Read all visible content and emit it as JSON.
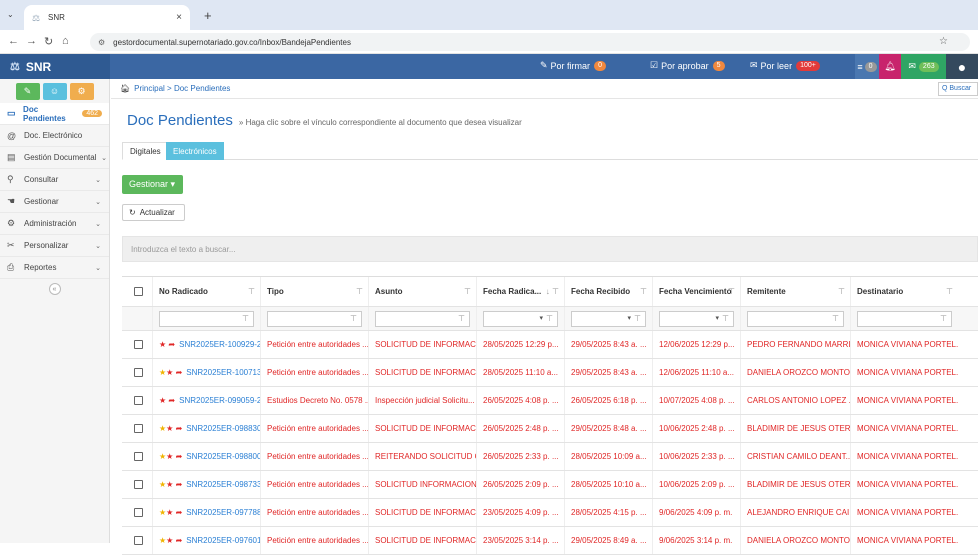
{
  "browser": {
    "tab_title": "SNR",
    "url": "gestordocumental.supernotariado.gov.co/Inbox/BandejaPendientes"
  },
  "header": {
    "brand": "SNR",
    "por_firmar": {
      "label": "Por firmar",
      "count": "0"
    },
    "por_aprobar": {
      "label": "Por aprobar",
      "count": "5"
    },
    "por_leer": {
      "label": "Por leer",
      "count": "100+"
    },
    "msg_count": "0",
    "mail_count": "263"
  },
  "sidebar": {
    "items": [
      {
        "label": "Doc Pendientes",
        "count": "462"
      },
      {
        "label": "Doc. Electrónico"
      },
      {
        "label": "Gestión Documental"
      },
      {
        "label": "Consultar"
      },
      {
        "label": "Gestionar"
      },
      {
        "label": "Administración"
      },
      {
        "label": "Personalizar"
      },
      {
        "label": "Reportes"
      }
    ]
  },
  "main": {
    "breadcrumb": "Principal > Doc Pendientes",
    "search_placeholder": "Q Buscar",
    "title": "Doc Pendientes",
    "subtitle": "» Haga clic sobre el vínculo correspondiente al documento que desea visualizar",
    "tabs": [
      "Digitales",
      "Electrónicos"
    ],
    "gestionar_label": "Gestionar ▾",
    "actualizar_label": "Actualizar",
    "filter_placeholder": "Introduzca el texto a buscar..."
  },
  "grid": {
    "columns": [
      "No Radicado",
      "Tipo",
      "Asunto",
      "Fecha Radica...",
      "Fecha Recibido",
      "Fecha Vencimiento",
      "Remitente",
      "Destinatario"
    ],
    "rows": [
      {
        "stars": "★",
        "radicado": "SNR2025ER-100929-2",
        "tipo": "Petición entre autoridades ...",
        "asunto": "SOLICITUD DE INFORMACI...",
        "fecha_rad": "28/05/2025 12:29 p...",
        "fecha_rec": "29/05/2025 8:43 a. ...",
        "fecha_venc": "12/06/2025 12:29 p...",
        "remitente": "PEDRO FERNANDO MARRI...",
        "destinatario": "MONICA VIVIANA PORTEL..."
      },
      {
        "stars": "★★",
        "radicado": "SNR2025ER-100713-2",
        "tipo": "Petición entre autoridades ...",
        "asunto": "SOLICITUD DE INFORMACI...",
        "fecha_rad": "28/05/2025 11:10 a...",
        "fecha_rec": "29/05/2025 8:43 a. ...",
        "fecha_venc": "12/06/2025 11:10 a...",
        "remitente": "DANIELA OROZCO MONTO...",
        "destinatario": "MONICA VIVIANA PORTEL..."
      },
      {
        "stars": "★",
        "radicado": "SNR2025ER-099059-2",
        "tipo": "Estudios Decreto No. 0578 ...",
        "asunto": "Inspección judicial Solicitu...",
        "fecha_rad": "26/05/2025 4:08 p. ...",
        "fecha_rec": "26/05/2025 6:18 p. ...",
        "fecha_venc": "10/07/2025 4:08 p. ...",
        "remitente": "CARLOS ANTONIO LOPEZ ...",
        "destinatario": "MONICA VIVIANA PORTEL..."
      },
      {
        "stars": "★★",
        "radicado": "SNR2025ER-098830-2",
        "tipo": "Petición entre autoridades ...",
        "asunto": "SOLICITUD DE INFORMACI...",
        "fecha_rad": "26/05/2025 2:48 p. ...",
        "fecha_rec": "29/05/2025 8:48 a. ...",
        "fecha_venc": "10/06/2025 2:48 p. ...",
        "remitente": "BLADIMIR DE JESUS OTER...",
        "destinatario": "MONICA VIVIANA PORTEL..."
      },
      {
        "stars": "★★",
        "radicado": "SNR2025ER-098800-2",
        "tipo": "Petición entre autoridades ...",
        "asunto": "REITERANDO SOLICITUD C...",
        "fecha_rad": "26/05/2025 2:33 p. ...",
        "fecha_rec": "28/05/2025 10:09 a...",
        "fecha_venc": "10/06/2025 2:33 p. ...",
        "remitente": "CRISTIAN CAMILO DEANT...",
        "destinatario": "MONICA VIVIANA PORTEL..."
      },
      {
        "stars": "★★",
        "radicado": "SNR2025ER-098733-2",
        "tipo": "Petición entre autoridades ...",
        "asunto": "SOLICITUD INFORMACION",
        "fecha_rad": "26/05/2025 2:09 p. ...",
        "fecha_rec": "28/05/2025 10:10 a...",
        "fecha_venc": "10/06/2025 2:09 p. ...",
        "remitente": "BLADIMIR DE JESUS OTER...",
        "destinatario": "MONICA VIVIANA PORTEL..."
      },
      {
        "stars": "★★",
        "radicado": "SNR2025ER-097788-2",
        "tipo": "Petición entre autoridades ...",
        "asunto": "SOLICITUD DE INFORMACI...",
        "fecha_rad": "23/05/2025 4:09 p. ...",
        "fecha_rec": "28/05/2025 4:15 p. ...",
        "fecha_venc": "9/06/2025 4:09 p. m.",
        "remitente": "ALEJANDRO ENRIQUE CAI...",
        "destinatario": "MONICA VIVIANA PORTEL..."
      },
      {
        "stars": "★★",
        "radicado": "SNR2025ER-097601-2",
        "tipo": "Petición entre autoridades ...",
        "asunto": "SOLICITUD DE INFORMACI...",
        "fecha_rad": "23/05/2025 3:14 p. ...",
        "fecha_rec": "29/05/2025 8:49 a. ...",
        "fecha_venc": "9/06/2025 3:14 p. m.",
        "remitente": "DANIELA OROZCO MONTO...",
        "destinatario": "MONICA VIVIANA PORTEL..."
      }
    ]
  }
}
